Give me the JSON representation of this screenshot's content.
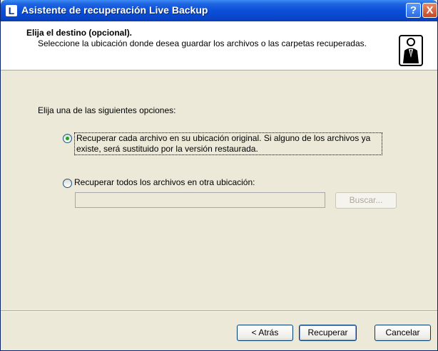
{
  "window": {
    "title": "Asistente de recuperación Live Backup",
    "app_icon_glyph": "L",
    "help_glyph": "?",
    "close_glyph": "X"
  },
  "header": {
    "title": "Elija el destino (opcional).",
    "subtitle": "Seleccione la ubicación donde desea guardar los archivos o las carpetas recuperadas."
  },
  "body": {
    "prompt": "Elija una de las siguientes opciones:",
    "option_original": {
      "label": "Recuperar cada archivo en su ubicación original. Si alguno de los archivos ya existe, será sustituido por la versión restaurada.",
      "checked": true
    },
    "option_other": {
      "label": "Recuperar todos los archivos en otra ubicación:",
      "checked": false
    },
    "path_value": "",
    "browse_label": "Buscar..."
  },
  "footer": {
    "back_label": "< Atrás",
    "recover_label": "Recuperar",
    "cancel_label": "Cancelar"
  },
  "colors": {
    "titlebar": "#0a4fd9",
    "dialog_bg": "#ece9d8",
    "header_bg": "#ffffff",
    "radio_dot": "#21a121"
  }
}
